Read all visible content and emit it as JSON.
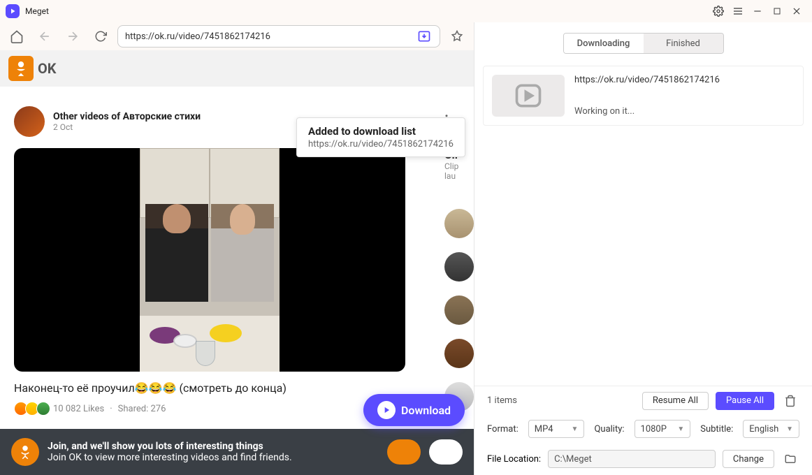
{
  "app": {
    "title": "Meget"
  },
  "url": "https://ok.ru/video/7451862174216",
  "tooltip": {
    "title": "Added to download list",
    "url": "https://ok.ru/video/7451862174216"
  },
  "ok": {
    "brand": "OK"
  },
  "post": {
    "author": "Other videos of Авторские стихи",
    "date": "2 Oct",
    "title": "Наконец-то её проучил😂😂😂 (смотреть до конца)",
    "likes": "10 082 Likes",
    "shared": "Shared: 276"
  },
  "side": {
    "title": "Cli",
    "sub1": "Clip",
    "sub2": "lau"
  },
  "banner": {
    "line1": "Join, and we'll show you lots of interesting things",
    "line2": "Join OK to view more interesting videos and find friends."
  },
  "download_button": "Download",
  "tabs": {
    "downloading": "Downloading",
    "finished": "Finished"
  },
  "dl_item": {
    "url": "https://ok.ru/video/7451862174216",
    "status": "Working on it..."
  },
  "items_count": "1 items",
  "resume": "Resume All",
  "pause": "Pause All",
  "format_label": "Format:",
  "format_value": "MP4",
  "quality_label": "Quality:",
  "quality_value": "1080P",
  "subtitle_label": "Subtitle:",
  "subtitle_value": "English",
  "loc_label": "File Location:",
  "loc_value": "C:\\Meget",
  "change": "Change"
}
